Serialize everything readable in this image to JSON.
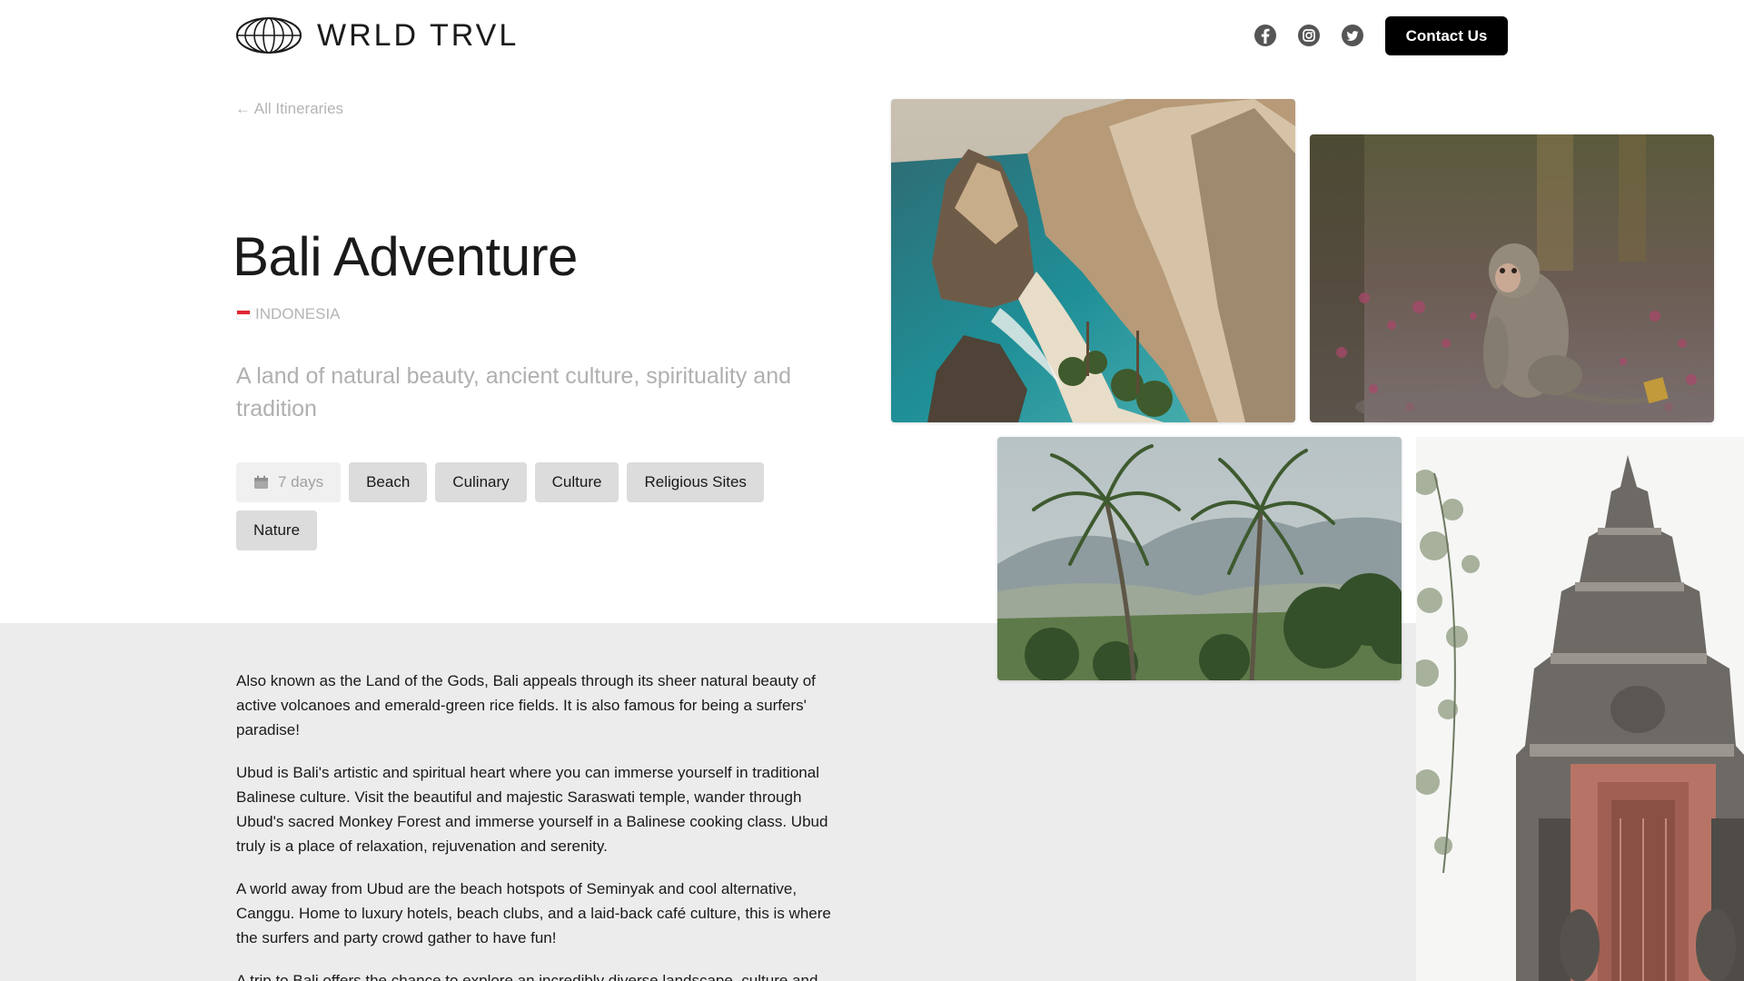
{
  "brand": {
    "name": "WRLD TRVL"
  },
  "header": {
    "social": [
      "facebook-icon",
      "instagram-icon",
      "twitter-icon"
    ],
    "contact_label": "Contact Us"
  },
  "nav": {
    "back_label": "← All Itineraries"
  },
  "trip": {
    "title": "Bali Adventure",
    "country": "INDONESIA",
    "subtitle": "A land of natural beauty, ancient culture, spirituality and tradition",
    "duration": "7 days",
    "tags": [
      "Beach",
      "Culinary",
      "Culture",
      "Religious Sites",
      "Nature"
    ]
  },
  "description": [
    "Also known as the Land of the Gods, Bali appeals through its sheer natural beauty of active volcanoes and emerald-green rice fields. It is also famous for being a surfers' paradise!",
    "Ubud is Bali's artistic and spiritual heart where you can immerse yourself in traditional Balinese culture. Visit the beautiful and majestic Saraswati temple, wander through Ubud's sacred Monkey Forest and immerse yourself in a Balinese cooking class. Ubud truly is a place of relaxation, rejuvenation and serenity.",
    "A world away from Ubud are the beach hotspots of Seminyak and cool alternative, Canggu. Home to luxury hotels, beach clubs, and a laid-back café culture, this is where the surfers and party crowd gather to have fun!",
    "A trip to Bali offers the chance to explore an incredibly diverse landscape, culture and"
  ],
  "colors": {
    "accent": "#000000",
    "tag_bg": "#dcdcdc",
    "muted_text": "#b0b0b0",
    "lower_band": "#ececec",
    "flag_red": "#e2242f"
  }
}
